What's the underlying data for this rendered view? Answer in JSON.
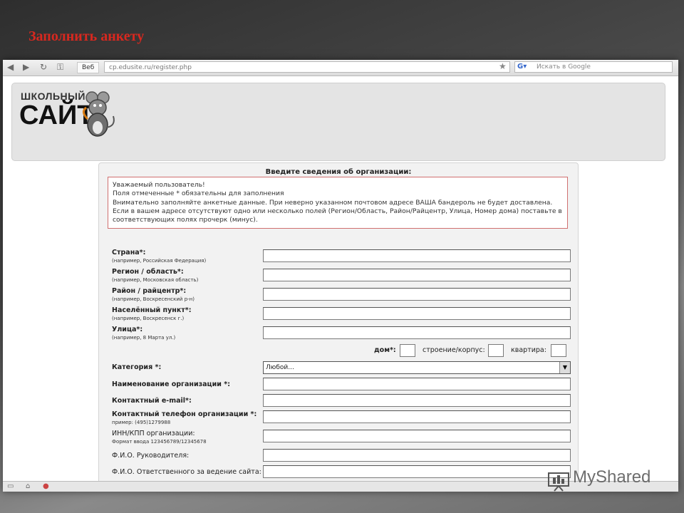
{
  "slide": {
    "title": "Заполнить анкету"
  },
  "browser": {
    "tab_label": "Веб",
    "url": "cp.edusite.ru/register.php",
    "search_placeholder": "Искать в Google",
    "search_engine_logo": "Google"
  },
  "site_logo": {
    "small": "ШКОЛЬНЫЙ",
    "big": "САЙТ",
    "icon": "mouse-mascot-icon"
  },
  "form": {
    "title": "Введите сведения об организации:",
    "notice": [
      "Уважаемый пользователь!",
      "Поля отмеченные * обязательны для заполнения",
      "Внимательно заполняйте анкетные данные. При неверно указанном почтовом адресе ВАША бандероль не будет доставлена.",
      "Если в вашем адресе отсутствуют одно или несколько полей (Регион/Область, Район/Райцентр, Улица, Номер дома) поставьте в",
      "соответствующих полях прочерк (минус)."
    ],
    "fields": [
      {
        "label": "Страна*:",
        "hint": "(например, Российская Федерация)"
      },
      {
        "label": "Регион / область*:",
        "hint": "(например, Московская область)"
      },
      {
        "label": "Район / райцентр*:",
        "hint": "(например, Воскресенский р-н)"
      },
      {
        "label": "Населённый пункт*:",
        "hint": "(например, Воскресенск г.)"
      },
      {
        "label": "Улица*:",
        "hint": "(например, 8 Марта ул.)"
      }
    ],
    "house_label": "дом*:",
    "building_label": "строение/корпус:",
    "apartment_label": "квартира:",
    "category_label": "Категория *:",
    "category_value": "Любой...",
    "org_name_label": "Наименование организации *:",
    "email_label": "Контактный e-mail*:",
    "phone_label": "Контактный телефон организации *:",
    "phone_hint": "пример: (495)1279988",
    "inn_label": "ИНН/КПП организации:",
    "inn_hint": "Формат ввода 123456789/12345678",
    "director_label": "Ф.И.О. Руководителя:",
    "responsible_label": "Ф.И.О. Ответственного за ведение сайта:"
  },
  "watermark": "MyShared"
}
